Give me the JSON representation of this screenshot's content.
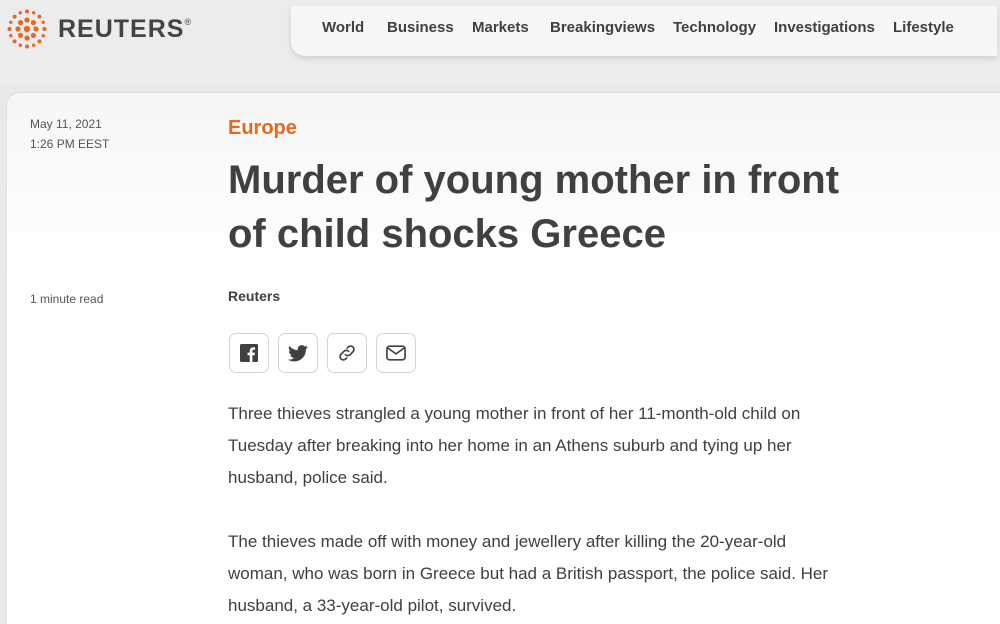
{
  "brand": {
    "name": "REUTERS",
    "mark": "®",
    "accent": "#e5691e"
  },
  "nav": {
    "items": [
      "World",
      "Business",
      "Markets",
      "Breakingviews",
      "Technology",
      "Investigations",
      "Lifestyle"
    ]
  },
  "article": {
    "date": "May 11, 2021",
    "time": "1:26 PM EEST",
    "read_time": "1 minute read",
    "section": "Europe",
    "headline_line1": "Murder of young mother in front",
    "headline_line2": "of child shocks Greece",
    "byline": "Reuters",
    "share_icons": [
      "facebook-icon",
      "twitter-icon",
      "link-icon",
      "email-icon"
    ],
    "paragraphs": [
      [
        "Three thieves strangled a young mother in front of her 11-month-old child on",
        "Tuesday after breaking into her home in an Athens suburb and tying up her",
        "husband, police said."
      ],
      [
        "The thieves made off with money and jewellery after killing the 20-year-old",
        "woman, who was born in Greece but had a British passport, the police said. Her",
        "husband, a 33-year-old pilot, survived."
      ]
    ]
  }
}
